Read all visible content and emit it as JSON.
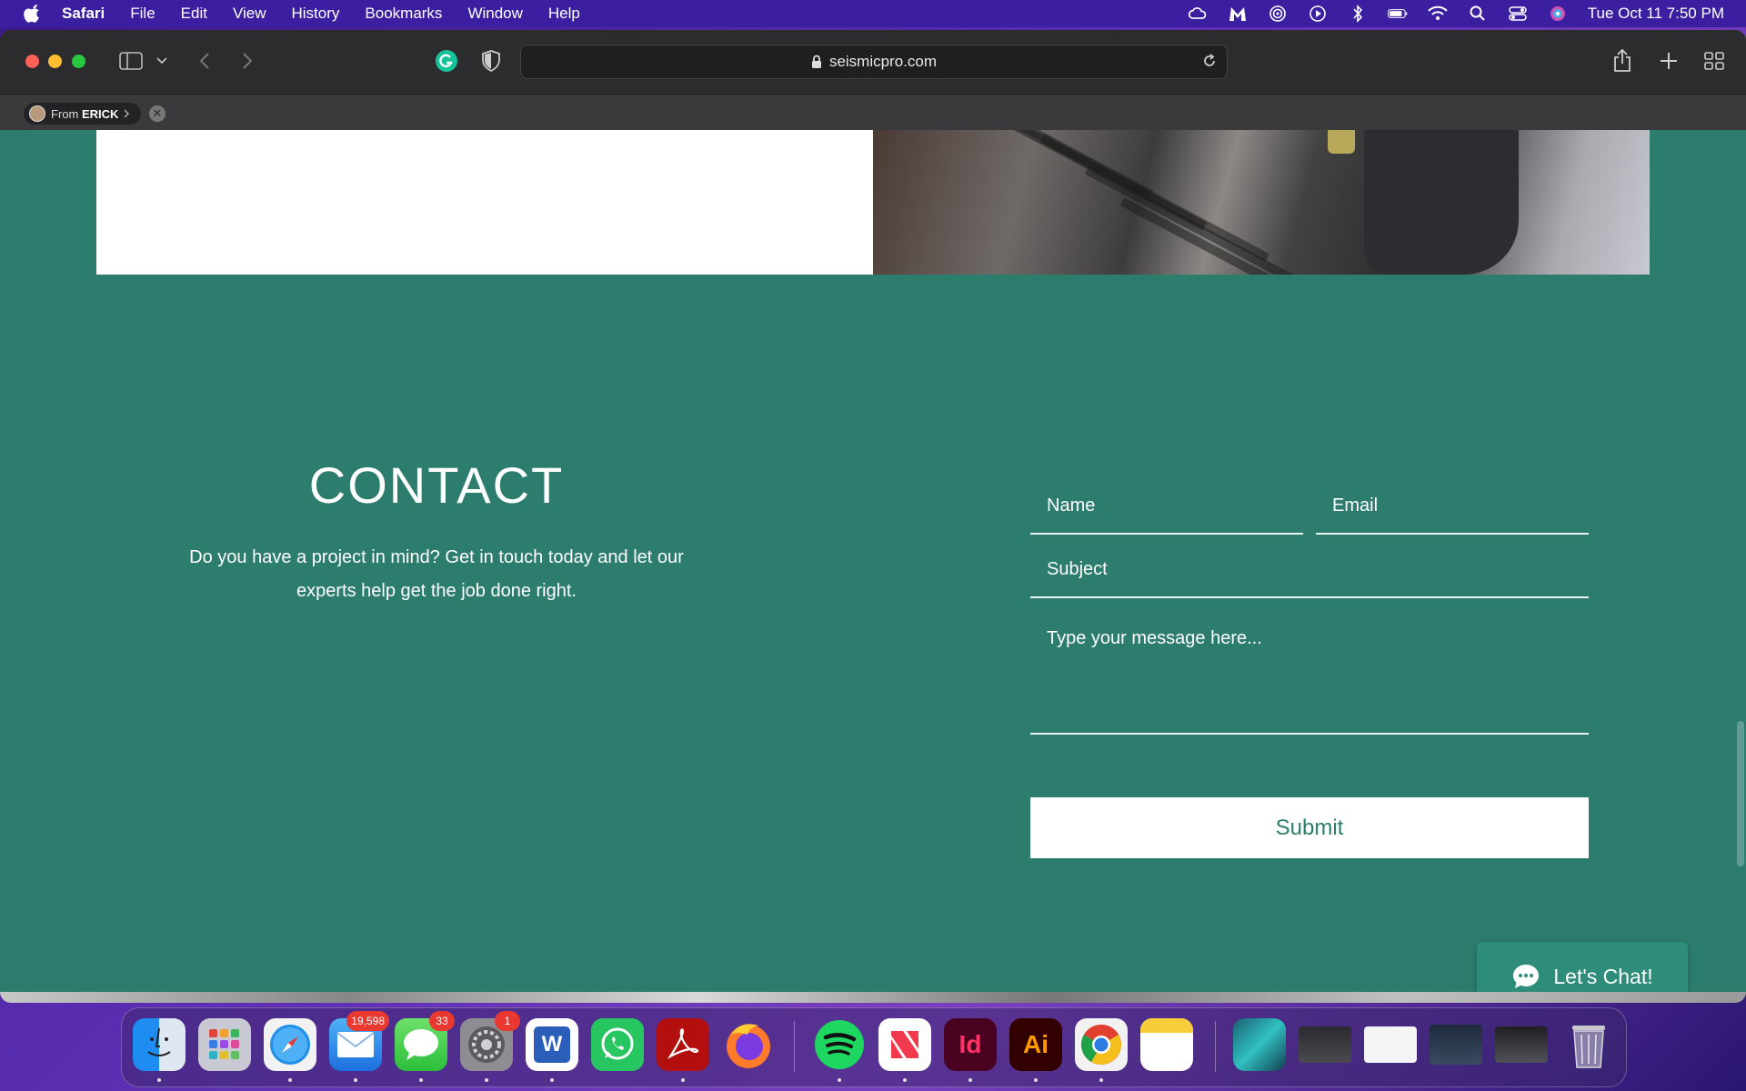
{
  "menubar": {
    "app_name": "Safari",
    "menus": [
      "File",
      "Edit",
      "View",
      "History",
      "Bookmarks",
      "Window",
      "Help"
    ],
    "clock": "Tue Oct 11  7:50 PM"
  },
  "browser": {
    "url": "seismicpro.com",
    "shared_from_prefix": "From",
    "shared_from_name": "ERICK"
  },
  "contact": {
    "title": "CONTACT",
    "description": "Do you have a project in mind? Get in touch today and let our experts help get the job done right.",
    "name_placeholder": "Name",
    "email_placeholder": "Email",
    "subject_placeholder": "Subject",
    "message_placeholder": "Type your message here...",
    "submit_label": "Submit"
  },
  "chat": {
    "label": "Let's Chat!"
  },
  "dock": {
    "mail_badge": "19,598",
    "messages_badge": "33",
    "settings_badge": "1",
    "word_letter": "W",
    "indesign_label": "Id",
    "illustrator_label": "Ai"
  },
  "colors": {
    "page_bg": "#2d7d6f",
    "accent_text": "#2d7d6f",
    "menubar": "#3b1fa0"
  }
}
